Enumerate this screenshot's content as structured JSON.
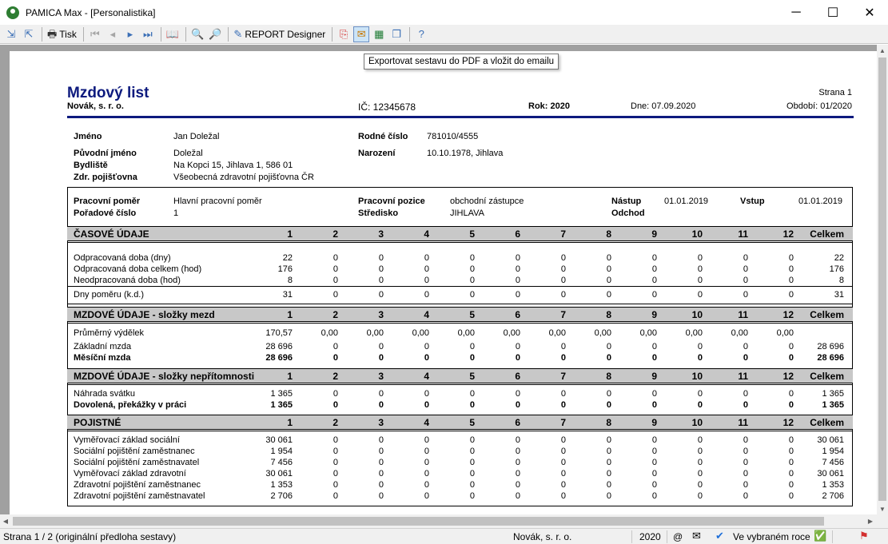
{
  "window": {
    "title": "PAMICA Max - [Personalistika]",
    "minimize": "─",
    "maximize": "☐",
    "close": "✕"
  },
  "toolbar": {
    "print_label": "Tisk",
    "report_designer_label": "REPORT Designer",
    "tooltip": "Exportovat sestavu do PDF a vložit do emailu"
  },
  "report": {
    "title": "Mzdový list",
    "company": "Novák, s. r. o.",
    "ico": "IČ: 12345678",
    "rok": "Rok: 2020",
    "dne": "Dne: 07.09.2020",
    "strana": "Strana 1",
    "obdobi": "Období: 01/2020",
    "person": {
      "jmeno_label": "Jméno",
      "jmeno": "Jan Doležal",
      "puvodni_label": "Původní jméno",
      "puvodni": "Doležal",
      "bydliste_label": "Bydliště",
      "bydliste": "Na Kopci 15, Jihlava 1, 586 01",
      "zdr_label": "Zdr. pojišťovna",
      "zdr": "Všeobecná zdravotní pojišťovna ČR",
      "rc_label": "Rodné číslo",
      "rc": "781010/4555",
      "narozeni_label": "Narození",
      "narozeni": "10.10.1978, Jihlava"
    },
    "employment": {
      "pomer_label": "Pracovní poměr",
      "pomer": "Hlavní pracovní poměr",
      "poradove_label": "Pořadové číslo",
      "poradove": "1",
      "pozice_label": "Pracovní pozice",
      "pozice": "obchodní zástupce",
      "stredisko_label": "Středisko",
      "stredisko": "JIHLAVA",
      "nastup_label": "Nástup",
      "nastup": "01.01.2019",
      "odchod_label": "Odchod",
      "vstup_label": "Vstup",
      "vstup": "01.01.2019"
    },
    "columns": [
      "1",
      "2",
      "3",
      "4",
      "5",
      "6",
      "7",
      "8",
      "9",
      "10",
      "11",
      "12",
      "Celkem"
    ],
    "sections": [
      {
        "title": "ČASOVÉ ÚDAJE",
        "rows": [
          {
            "label": "Odpracovaná doba (dny)",
            "bold": false,
            "values": [
              "22",
              "0",
              "0",
              "0",
              "0",
              "0",
              "0",
              "0",
              "0",
              "0",
              "0",
              "0",
              "22"
            ]
          },
          {
            "label": "Odpracovaná doba celkem (hod)",
            "bold": false,
            "values": [
              "176",
              "0",
              "0",
              "0",
              "0",
              "0",
              "0",
              "0",
              "0",
              "0",
              "0",
              "0",
              "176"
            ]
          },
          {
            "label": "Neodpracovaná doba (hod)",
            "bold": false,
            "values": [
              "8",
              "0",
              "0",
              "0",
              "0",
              "0",
              "0",
              "0",
              "0",
              "0",
              "0",
              "0",
              "8"
            ]
          },
          {
            "label": "Dny poměru (k.d.)",
            "bold": false,
            "values": [
              "31",
              "0",
              "0",
              "0",
              "0",
              "0",
              "0",
              "0",
              "0",
              "0",
              "0",
              "0",
              "31"
            ]
          }
        ]
      },
      {
        "title": "MZDOVÉ ÚDAJE - složky mezd",
        "rows": [
          {
            "label": "Průměrný výdělek",
            "bold": false,
            "values": [
              "170,57",
              "0,00",
              "0,00",
              "0,00",
              "0,00",
              "0,00",
              "0,00",
              "0,00",
              "0,00",
              "0,00",
              "0,00",
              "0,00",
              ""
            ]
          },
          {
            "label": "Základní mzda",
            "bold": false,
            "values": [
              "28 696",
              "0",
              "0",
              "0",
              "0",
              "0",
              "0",
              "0",
              "0",
              "0",
              "0",
              "0",
              "28 696"
            ]
          },
          {
            "label": "Měsíční mzda",
            "bold": true,
            "values": [
              "28 696",
              "0",
              "0",
              "0",
              "0",
              "0",
              "0",
              "0",
              "0",
              "0",
              "0",
              "0",
              "28 696"
            ]
          }
        ]
      },
      {
        "title": "MZDOVÉ ÚDAJE - složky nepřítomnosti",
        "rows": [
          {
            "label": "Náhrada svátku",
            "bold": false,
            "values": [
              "1 365",
              "0",
              "0",
              "0",
              "0",
              "0",
              "0",
              "0",
              "0",
              "0",
              "0",
              "0",
              "1 365"
            ]
          },
          {
            "label": "Dovolená, překážky v práci",
            "bold": true,
            "values": [
              "1 365",
              "0",
              "0",
              "0",
              "0",
              "0",
              "0",
              "0",
              "0",
              "0",
              "0",
              "0",
              "1 365"
            ]
          }
        ]
      },
      {
        "title": "POJISTNÉ",
        "rows": [
          {
            "label": "Vyměřovací základ sociální",
            "bold": false,
            "values": [
              "30 061",
              "0",
              "0",
              "0",
              "0",
              "0",
              "0",
              "0",
              "0",
              "0",
              "0",
              "0",
              "30 061"
            ]
          },
          {
            "label": "Sociální pojištění zaměstnanec",
            "bold": false,
            "values": [
              "1 954",
              "0",
              "0",
              "0",
              "0",
              "0",
              "0",
              "0",
              "0",
              "0",
              "0",
              "0",
              "1 954"
            ]
          },
          {
            "label": "Sociální pojištění zaměstnavatel",
            "bold": false,
            "values": [
              "7 456",
              "0",
              "0",
              "0",
              "0",
              "0",
              "0",
              "0",
              "0",
              "0",
              "0",
              "0",
              "7 456"
            ]
          },
          {
            "label": "Vyměřovací základ zdravotní",
            "bold": false,
            "values": [
              "30 061",
              "0",
              "0",
              "0",
              "0",
              "0",
              "0",
              "0",
              "0",
              "0",
              "0",
              "0",
              "30 061"
            ]
          },
          {
            "label": "Zdravotní pojištění zaměstnanec",
            "bold": false,
            "values": [
              "1 353",
              "0",
              "0",
              "0",
              "0",
              "0",
              "0",
              "0",
              "0",
              "0",
              "0",
              "0",
              "1 353"
            ]
          },
          {
            "label": "Zdravotní pojištění zaměstnavatel",
            "bold": false,
            "values": [
              "2 706",
              "0",
              "0",
              "0",
              "0",
              "0",
              "0",
              "0",
              "0",
              "0",
              "0",
              "0",
              "2 706"
            ]
          }
        ]
      }
    ]
  },
  "status": {
    "page": "Strana 1 / 2  (originální předloha sestavy)",
    "company": "Novák, s. r. o.",
    "year": "2020",
    "at": "@",
    "selected_year": "Ve vybraném roce"
  }
}
